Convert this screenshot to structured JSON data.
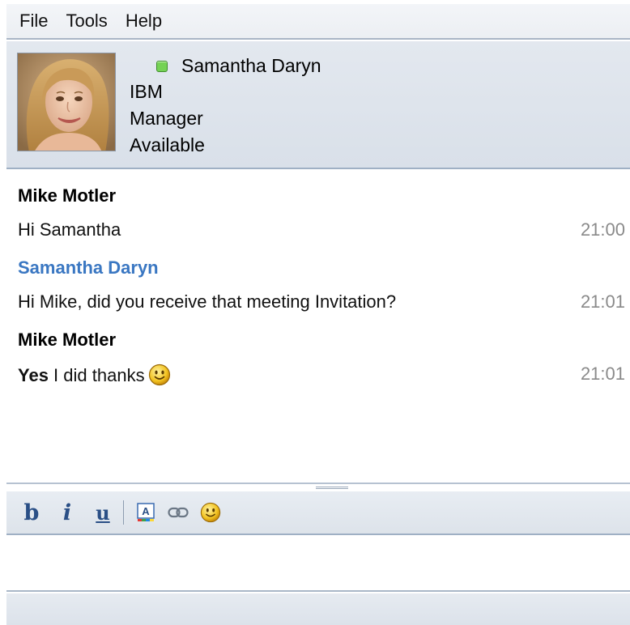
{
  "menu": {
    "file": "File",
    "tools": "Tools",
    "help": "Help"
  },
  "contact": {
    "name": "Samantha Daryn",
    "company": "IBM",
    "title": "Manager",
    "status": "Available",
    "status_color": "#75d255"
  },
  "messages": [
    {
      "sender": "Mike Motler",
      "sender_color": "#000000",
      "text": "Hi Samantha",
      "time": "21:00"
    },
    {
      "sender": "Samantha Daryn",
      "sender_color": "#3a77c2",
      "text": "Hi Mike, did you receive that meeting Invitation?",
      "time": "21:01"
    },
    {
      "sender": "Mike Motler",
      "sender_color": "#000000",
      "text_bold": "Yes",
      "text": " I did thanks",
      "emoji": "smiley-icon",
      "time": "21:01"
    }
  ],
  "toolbar": {
    "bold_label": "b",
    "italic_label": "i",
    "underline_label": "u",
    "icons": [
      "font-color-icon",
      "link-icon",
      "emoticon-icon"
    ]
  },
  "colors": {
    "accent_blue": "#3a77c2",
    "time_gray": "#8a8a8a",
    "panel_bg": "#dde3ea"
  }
}
